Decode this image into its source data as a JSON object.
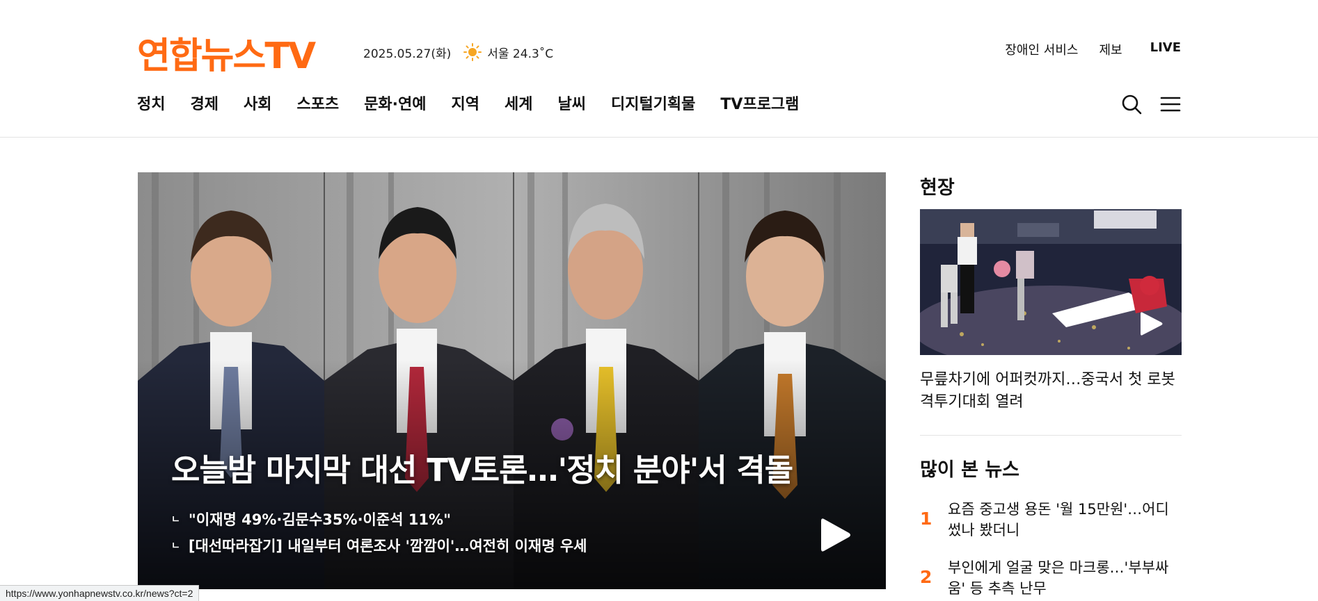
{
  "brand": {
    "logo_text": "연합뉴스TV",
    "accent_color": "#ff6a13"
  },
  "header": {
    "date": "2025.05.27(화)",
    "weather_icon": "sun-icon",
    "weather": "서울 24.3˚C",
    "util_links": [
      "장애인 서비스",
      "제보",
      "LIVE"
    ],
    "nav": [
      "정치",
      "경제",
      "사회",
      "스포츠",
      "문화·연예",
      "지역",
      "세계",
      "날씨",
      "디지털기획물",
      "TV프로그램"
    ],
    "icons": [
      "search-icon",
      "menu-icon"
    ]
  },
  "hero": {
    "title": "오늘밤 마지막 대선 TV토론…'정치 분야'서 격돌",
    "related": [
      "\"이재명 49%·김문수35%·이준석 11%\"",
      "[대선따라잡기] 내일부터 여론조사 '깜깜이'…여전히 이재명 우세"
    ],
    "arrow_glyph": "ㄴ"
  },
  "field": {
    "section_title": "현장",
    "caption": "무릎차기에 어퍼컷까지…중국서 첫 로봇 격투기대회 열려"
  },
  "popular": {
    "section_title": "많이 본 뉴스",
    "items": [
      {
        "rank": "1",
        "title": "요즘 중고생 용돈 '월 15만원'…어디 썼나 봤더니"
      },
      {
        "rank": "2",
        "title": "부인에게 얼굴 맞은 마크롱…'부부싸움' 등 추측 난무"
      }
    ]
  },
  "status_bar": {
    "url": "https://www.yonhapnewstv.co.kr/news?ct=2"
  }
}
